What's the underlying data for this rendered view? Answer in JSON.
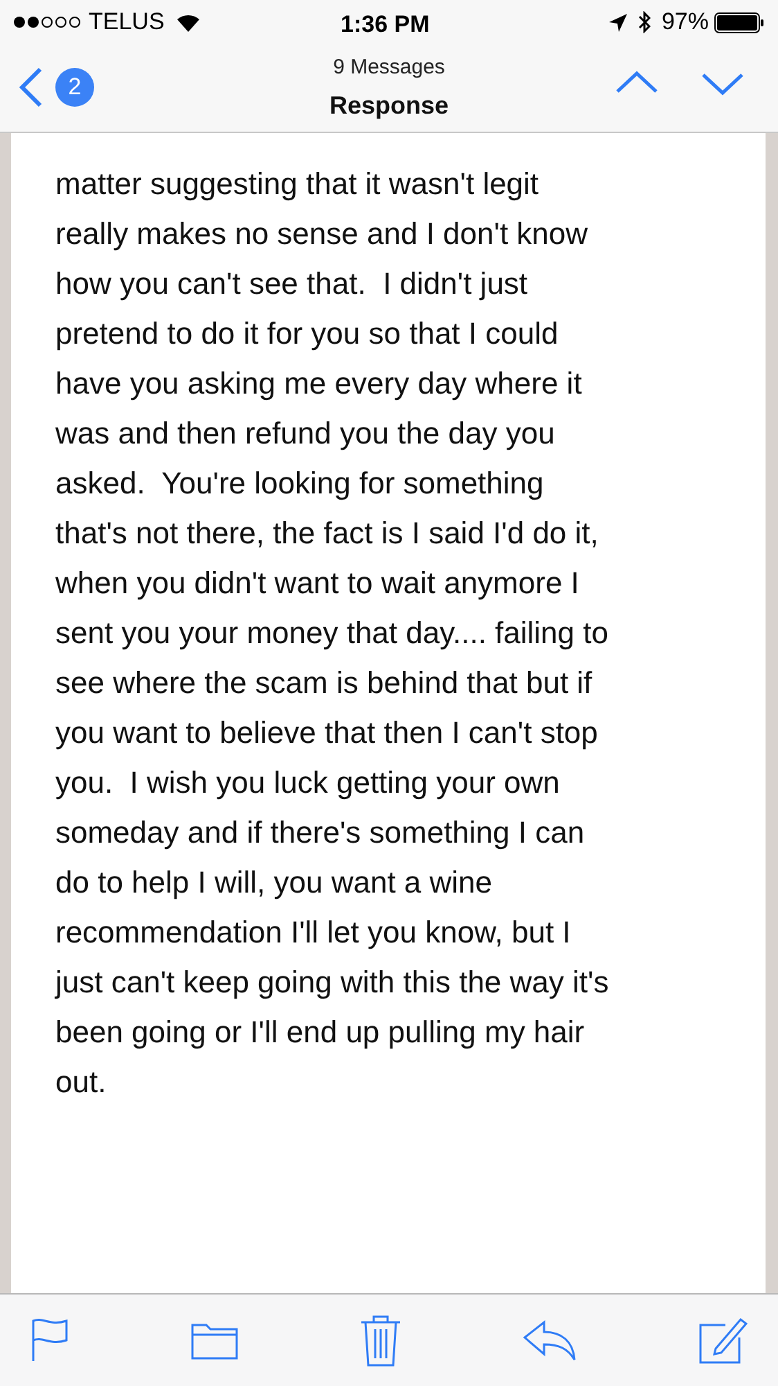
{
  "status_bar": {
    "carrier": "TELUS",
    "time": "1:36 PM",
    "battery": "97%"
  },
  "nav_bar": {
    "back_badge": "2",
    "subtitle": "9 Messages",
    "title": "Response"
  },
  "message": {
    "body": "matter suggesting that it wasn't legit\nreally makes no sense and I don't know\nhow you can't see that.  I didn't just\npretend to do it for you so that I could\nhave you asking me every day where it\nwas and then refund you the day you\nasked.  You're looking for something\nthat's not there, the fact is I said I'd do it,\nwhen you didn't want to wait anymore I\nsent you your money that day.... failing to\nsee where the scam is behind that but if\nyou want to believe that then I can't stop\nyou.  I wish you luck getting your own\nsomeday and if there's something I can\ndo to help I will, you want a wine\nrecommendation I'll let you know, but I\njust can't keep going with this the way it's\nbeen going or I'll end up pulling my hair\nout."
  }
}
